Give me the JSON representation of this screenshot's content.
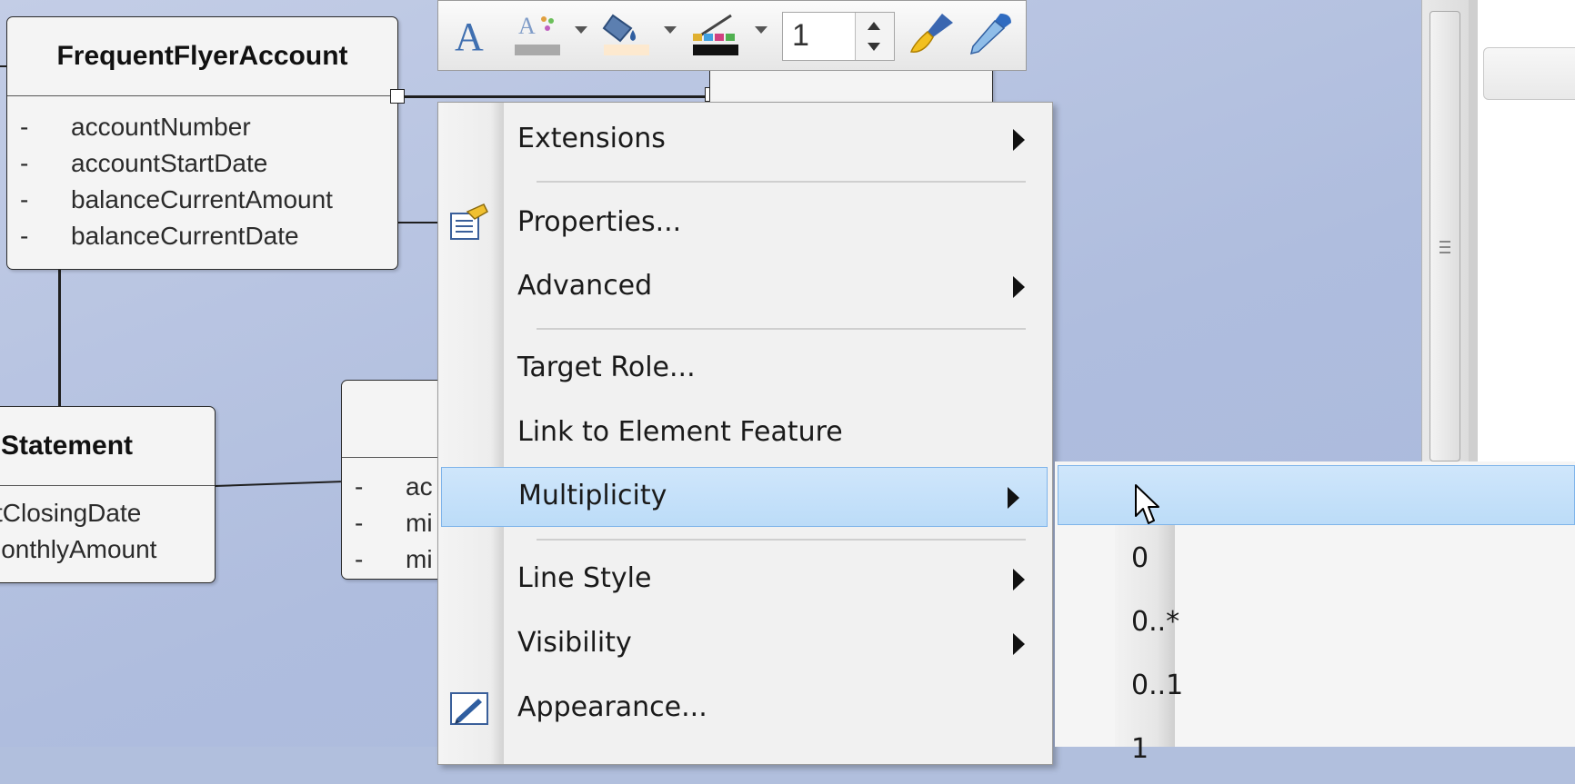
{
  "diagram": {
    "classes": [
      {
        "id": "frequent-flyer-account",
        "name": "FrequentFlyerAccount",
        "attributes": [
          {
            "visibility": "-",
            "name": "accountNumber"
          },
          {
            "visibility": "-",
            "name": "accountStartDate"
          },
          {
            "visibility": "-",
            "name": "balanceCurrentAmount"
          },
          {
            "visibility": "-",
            "name": "balanceCurrentDate"
          }
        ]
      },
      {
        "id": "statement",
        "name": "Statement",
        "attributes": [
          {
            "visibility": "",
            "name": "tClosingDate"
          },
          {
            "visibility": "",
            "name": "lonthlyAmount"
          }
        ]
      },
      {
        "id": "partial-class",
        "name": "",
        "attributes": [
          {
            "visibility": "-",
            "name": "ac"
          },
          {
            "visibility": "-",
            "name": "mi"
          },
          {
            "visibility": "-",
            "name": "mi"
          }
        ]
      }
    ]
  },
  "toolbar": {
    "items": [
      {
        "icon": "font-icon"
      },
      {
        "icon": "font-color-icon"
      },
      {
        "icon": "fill-color-icon"
      },
      {
        "icon": "line-color-icon"
      },
      {
        "icon": "paint-brush-icon"
      },
      {
        "icon": "eyedropper-icon"
      }
    ],
    "line_width": "1"
  },
  "context_menu": {
    "items": [
      {
        "label": "Extensions",
        "submenu": true
      },
      {
        "label": "Properties...",
        "submenu": false,
        "icon": "properties-icon"
      },
      {
        "label": "Advanced",
        "submenu": true
      },
      {
        "label": "Target Role...",
        "submenu": false
      },
      {
        "label": "Link to Element Feature",
        "submenu": false
      },
      {
        "label": "Multiplicity",
        "submenu": true,
        "highlighted": true
      },
      {
        "label": "Line Style",
        "submenu": true
      },
      {
        "label": "Visibility",
        "submenu": true
      },
      {
        "label": "Appearance...",
        "submenu": false,
        "icon": "appearance-icon"
      }
    ]
  },
  "multiplicity_submenu": {
    "items": [
      {
        "label": "",
        "highlighted": true
      },
      {
        "label": "0"
      },
      {
        "label": "0..*"
      },
      {
        "label": "0..1"
      },
      {
        "label": "1"
      }
    ]
  },
  "colors": {
    "canvas": "#b1bfdd",
    "highlight": "#c6e0f9",
    "highlight_border": "#7eb4ea",
    "menu_bg": "#f1f1f1"
  }
}
